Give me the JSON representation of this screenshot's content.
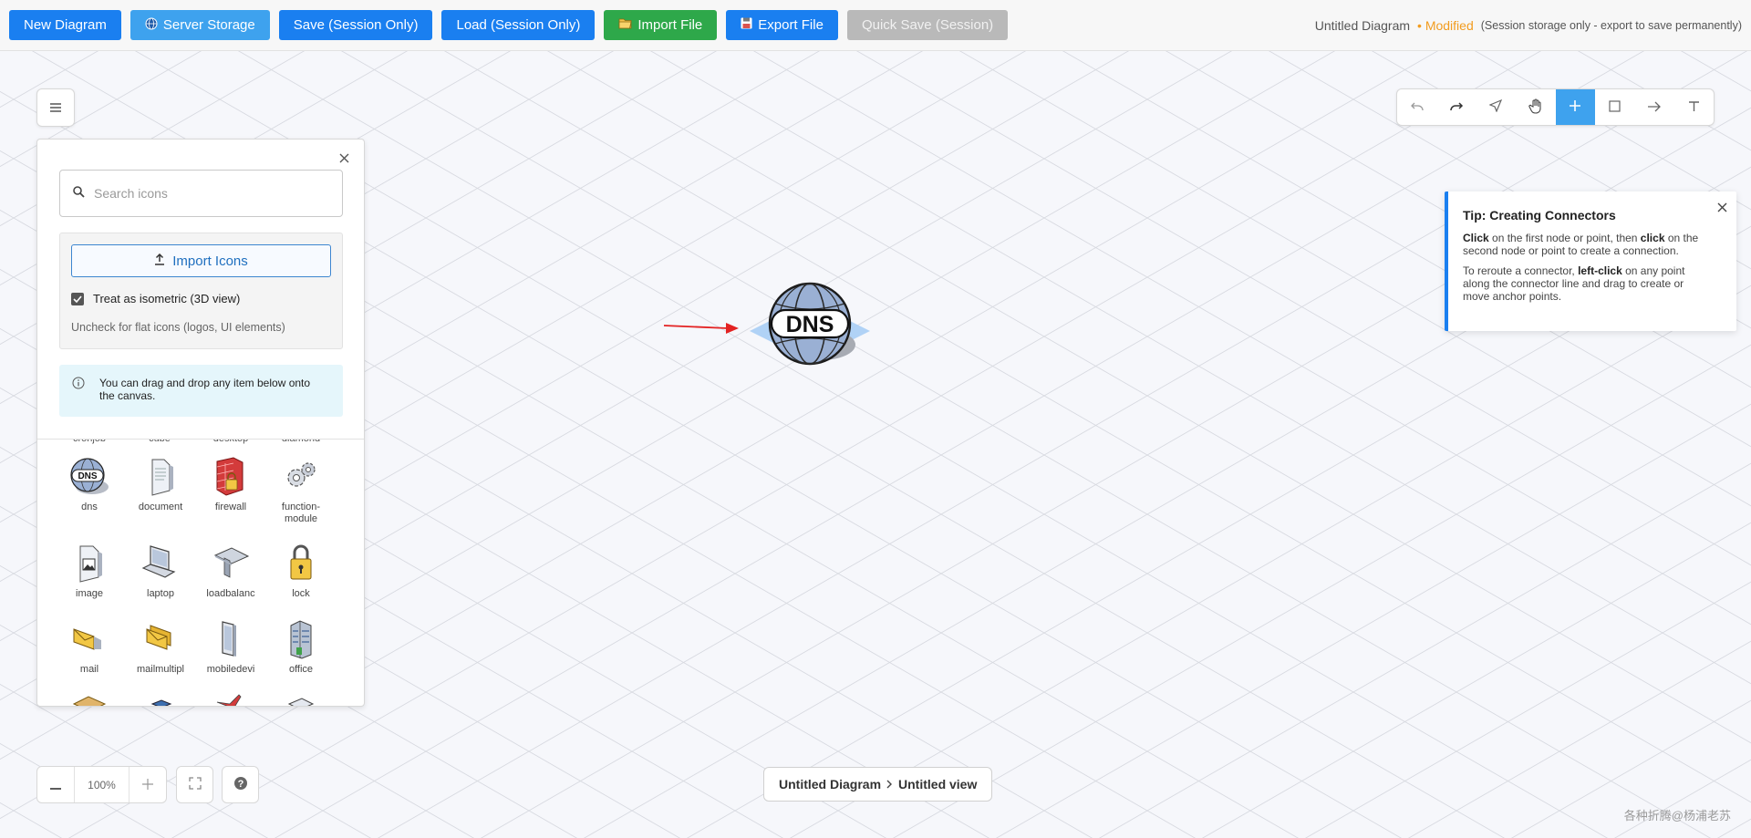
{
  "topbar": {
    "new_diagram": "New Diagram",
    "server_storage": "Server Storage",
    "save_session": "Save (Session Only)",
    "load_session": "Load (Session Only)",
    "import_file": "Import File",
    "export_file": "Export File",
    "quick_save": "Quick Save (Session)",
    "diagram_title": "Untitled Diagram",
    "modified": "• Modified",
    "storage_note": "(Session storage only - export to save permanently)"
  },
  "panel": {
    "search_placeholder": "Search icons",
    "import_icons": "Import Icons",
    "isometric_label": "Treat as isometric (3D view)",
    "isometric_checked": true,
    "isometric_hint": "Uncheck for flat icons (logos, UI elements)",
    "drag_info": "You can drag and drop any item below onto the canvas.",
    "cut_labels": [
      "cronjob",
      "cube",
      "desktop",
      "diamond"
    ],
    "icons": [
      {
        "name": "dns",
        "label": "dns"
      },
      {
        "name": "document",
        "label": "document"
      },
      {
        "name": "firewall",
        "label": "firewall"
      },
      {
        "name": "function-module",
        "label": "function-module"
      },
      {
        "name": "image",
        "label": "image"
      },
      {
        "name": "laptop",
        "label": "laptop"
      },
      {
        "name": "loadbalancer",
        "label": "loadbalanc"
      },
      {
        "name": "lock",
        "label": "lock"
      },
      {
        "name": "mail",
        "label": "mail"
      },
      {
        "name": "mailmultiple",
        "label": "mailmultipl"
      },
      {
        "name": "mobiledevice",
        "label": "mobiledevi"
      },
      {
        "name": "office",
        "label": "office"
      }
    ]
  },
  "tools": [
    "undo-icon",
    "redo-icon",
    "select-icon",
    "pan-icon",
    "add-icon",
    "rectangle-icon",
    "connector-icon",
    "text-icon"
  ],
  "active_tool": "add-icon",
  "tip": {
    "title": "Tip: Creating Connectors",
    "p1_a": "Click",
    "p1_b": " on the first node or point, then ",
    "p1_c": "click",
    "p1_d": " on the second node or point to create a connection.",
    "p2_a": "To reroute a connector, ",
    "p2_b": "left-click",
    "p2_c": " on any point along the connector line and drag to create or move anchor points."
  },
  "node": {
    "label": "DNS"
  },
  "zoom": {
    "level": "100%"
  },
  "breadcrumb": {
    "diagram": "Untitled Diagram",
    "view": "Untitled view"
  },
  "watermark": "各种折腾@杨浦老苏",
  "colors": {
    "primary": "#1a7ff0",
    "success": "#2ea84a",
    "modified": "#f29c1f",
    "active_tool": "#3ea2ee"
  }
}
